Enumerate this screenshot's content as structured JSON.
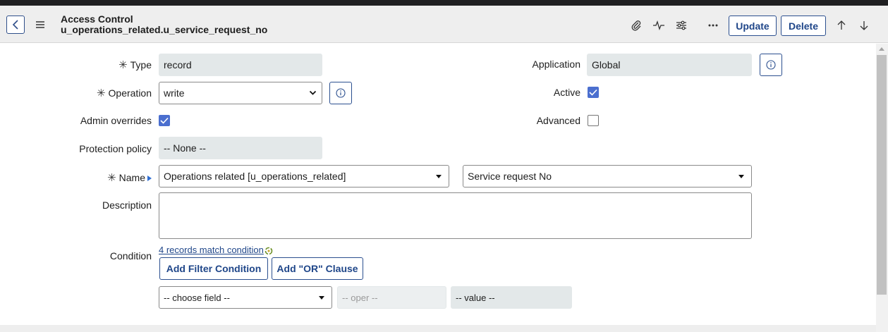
{
  "header": {
    "title_line1": "Access Control",
    "title_line2": "u_operations_related.u_service_request_no",
    "update_label": "Update",
    "delete_label": "Delete",
    "icons": [
      "back-icon",
      "menu-icon",
      "paperclip-icon",
      "activity-icon",
      "settings-sliders-icon",
      "more-icon",
      "up-arrow-icon",
      "down-arrow-icon"
    ]
  },
  "form": {
    "type": {
      "label": "Type",
      "value": "record",
      "required": true
    },
    "application": {
      "label": "Application",
      "value": "Global"
    },
    "operation": {
      "label": "Operation",
      "value": "write",
      "required": true
    },
    "active": {
      "label": "Active",
      "checked": true
    },
    "admin_overrides": {
      "label": "Admin overrides",
      "checked": true
    },
    "advanced": {
      "label": "Advanced",
      "checked": false
    },
    "protection_policy": {
      "label": "Protection policy",
      "value": "-- None --"
    },
    "name": {
      "label": "Name",
      "required": true,
      "table_value": "Operations related [u_operations_related]",
      "field_value": "Service request No"
    },
    "description": {
      "label": "Description",
      "value": ""
    },
    "condition": {
      "label": "Condition",
      "match_link": "4 records match condition",
      "add_filter_label": "Add Filter Condition",
      "add_or_label": "Add \"OR\" Clause",
      "field_placeholder": "-- choose field --",
      "oper_placeholder": "-- oper --",
      "value_placeholder": "-- value --"
    }
  },
  "colors": {
    "accent": "#1f4689",
    "checkbox_checked": "#4b6fcf",
    "readonly_bg": "#e3e8e9",
    "header_bg": "#eeeeee"
  }
}
